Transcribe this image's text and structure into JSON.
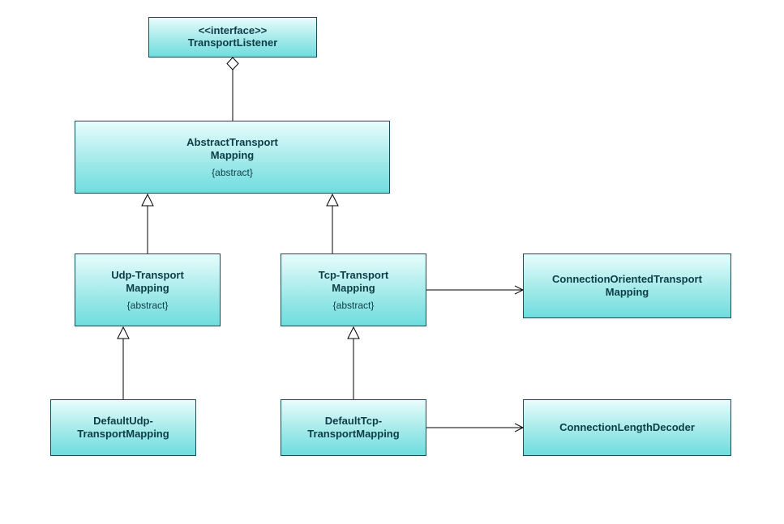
{
  "boxes": {
    "transportListener": {
      "stereotype": "<<interface>>",
      "name": "TransportListener"
    },
    "abstractTransportMapping": {
      "name1": "AbstractTransport",
      "name2": "Mapping",
      "constraint": "{abstract}"
    },
    "udpTransportMapping": {
      "name1": "Udp-Transport",
      "name2": "Mapping",
      "constraint": "{abstract}"
    },
    "tcpTransportMapping": {
      "name1": "Tcp-Transport",
      "name2": "Mapping",
      "constraint": "{abstract}"
    },
    "connectionOrientedTransportMapping": {
      "name1": "ConnectionOrientedTransport",
      "name2": "Mapping"
    },
    "defaultUdpTransportMapping": {
      "name1": "DefaultUdp-",
      "name2": "TransportMapping"
    },
    "defaultTcpTransportMapping": {
      "name1": "DefaultTcp-",
      "name2": "TransportMapping"
    },
    "connectionLengthDecoder": {
      "name": "ConnectionLengthDecoder"
    }
  }
}
